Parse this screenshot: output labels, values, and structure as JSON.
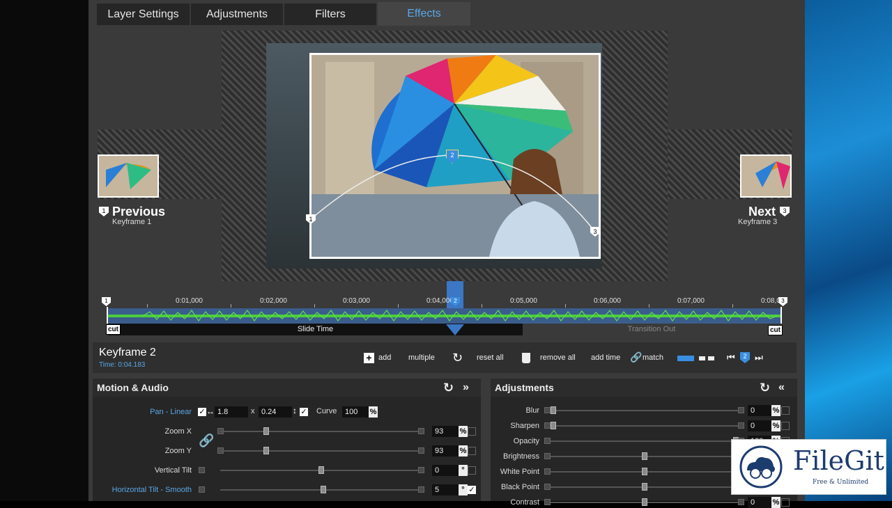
{
  "tabs": [
    {
      "label": "Layer Settings"
    },
    {
      "label": "Adjustments"
    },
    {
      "label": "Filters"
    },
    {
      "label": "Effects"
    }
  ],
  "preview": {
    "previous_label": "Previous",
    "previous_sub": "Keyframe 1",
    "next_label": "Next",
    "next_sub": "Keyframe 3",
    "kf1": "1",
    "kf2": "2",
    "kf3": "3"
  },
  "timeline": {
    "ticks": [
      "0:01,000",
      "0:02,000",
      "0:03,000",
      "0:04,000",
      "0:05,000",
      "0:06,000",
      "0:07,000",
      "0:08,0"
    ],
    "slide_time": "Slide Time",
    "transition_out": "Transition Out",
    "cut": "cut",
    "marker_start": "1",
    "marker_current": "2",
    "marker_end": "3"
  },
  "keyframe": {
    "title": "Keyframe 2",
    "time": "Time: 0:04.183"
  },
  "toolbar": {
    "add": "add",
    "multiple": "multiple",
    "reset_all": "reset all",
    "remove_all": "remove all",
    "add_time": "add time",
    "match": "match",
    "current": "2"
  },
  "motion": {
    "title": "Motion & Audio",
    "pan_label": "Pan - Linear",
    "pan_x": "1.8",
    "x_sep": "x",
    "pan_y": "0.24",
    "curve_label": "Curve",
    "curve_value": "100",
    "pct": "%",
    "deg": "°",
    "rows": [
      {
        "label": "Zoom X",
        "value": "93",
        "unit": "%",
        "level": 0.22
      },
      {
        "label": "Zoom Y",
        "value": "93",
        "unit": "%",
        "level": 0.22
      },
      {
        "label": "Vertical Tilt",
        "value": "0",
        "unit": "°",
        "level": 0.5
      },
      {
        "label": "Horizontal Tilt - Smooth",
        "value": "5",
        "unit": "°",
        "level": 0.51
      }
    ]
  },
  "adjustments": {
    "title": "Adjustments",
    "rows": [
      {
        "label": "Blur",
        "value": "0",
        "unit": "%",
        "level": 0.0
      },
      {
        "label": "Sharpen",
        "value": "0",
        "unit": "%",
        "level": 0.0
      },
      {
        "label": "Opacity",
        "value": "100",
        "unit": "%",
        "level": 1.0
      },
      {
        "label": "Brightness",
        "value": "",
        "unit": "",
        "level": 0.5
      },
      {
        "label": "White Point",
        "value": "",
        "unit": "",
        "level": 0.5
      },
      {
        "label": "Black Point",
        "value": "",
        "unit": "",
        "level": 0.5
      },
      {
        "label": "Contrast",
        "value": "0",
        "unit": "%",
        "level": 0.5
      }
    ]
  },
  "watermark": {
    "brand": "FileGit",
    "tagline": "Free & Unlimited"
  },
  "colors": {
    "accent": "#5aa7e8",
    "waveform": "#4ccd3c",
    "panel_bg": "#262626"
  }
}
